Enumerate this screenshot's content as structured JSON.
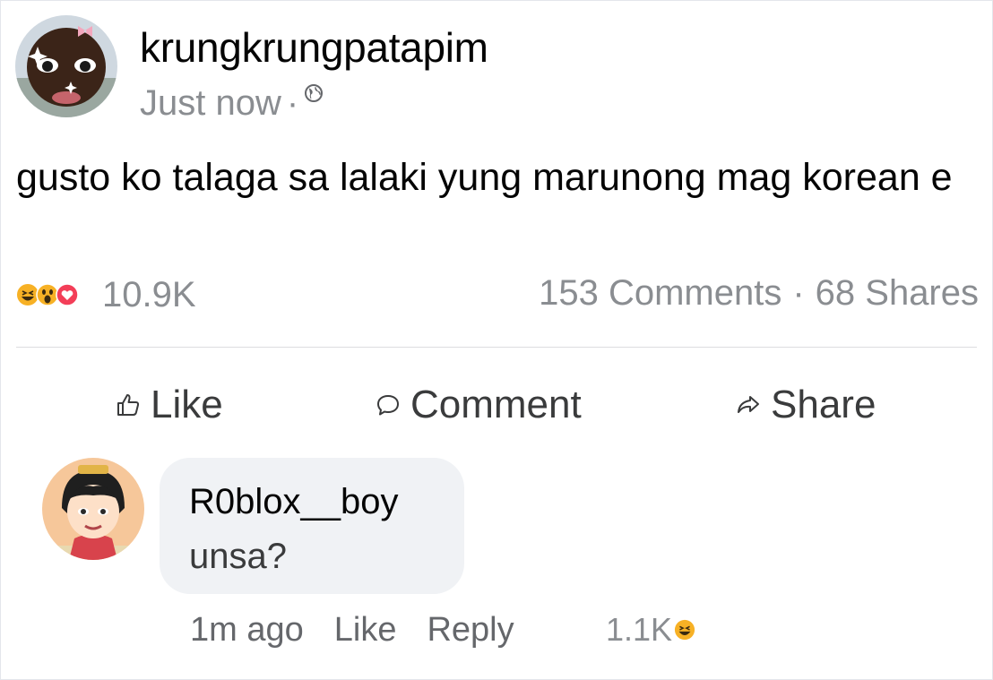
{
  "post": {
    "author": "krungkrungpatapim",
    "time": "Just now",
    "separator": "·",
    "privacy_icon": "globe-icon",
    "text": "gusto ko talaga sa lalaki yung marunong mag korean e",
    "reaction_icons": [
      "haha-icon",
      "wow-icon",
      "love-icon"
    ],
    "reaction_count": "10.9K",
    "comments": "153 Comments",
    "stats_separator": "·",
    "shares": "68 Shares"
  },
  "actions": {
    "like": "Like",
    "comment": "Comment",
    "share": "Share"
  },
  "comment": {
    "author": "R0blox__boy",
    "text": "unsa?",
    "time": "1m ago",
    "like": "Like",
    "reply": "Reply",
    "reaction_count": "1.1K",
    "reaction_icon": "haha-icon"
  },
  "colors": {
    "text": "#050505",
    "muted": "#8a8d91",
    "bubble": "#f0f2f5",
    "love": "#f33e58",
    "reaction_yellow": "#f7b125"
  }
}
